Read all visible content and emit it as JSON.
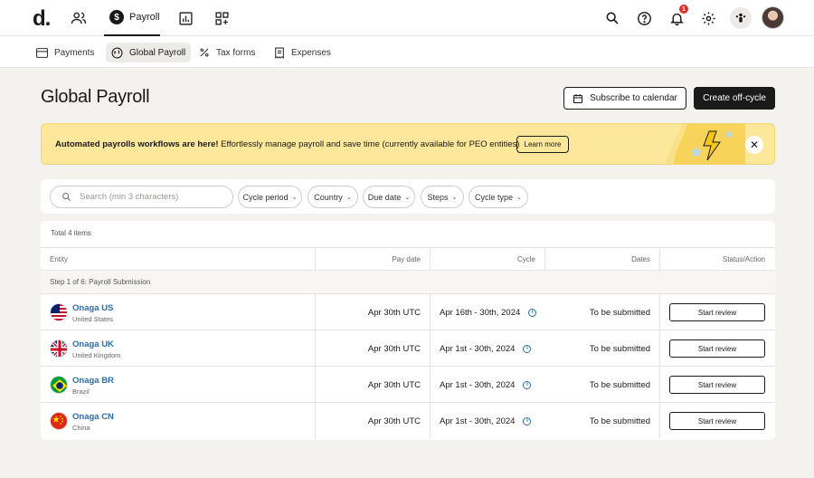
{
  "topbar": {
    "logo": "d.",
    "payroll_label": "Payroll",
    "notification_count": "1",
    "icons": [
      "people-icon",
      "dollar-icon",
      "chart-icon",
      "apps-add-icon",
      "search-icon",
      "help-icon",
      "bell-icon",
      "gear-icon",
      "org-icon",
      "avatar"
    ]
  },
  "subnav": {
    "items": [
      {
        "label": "Payments",
        "icon": "card-icon"
      },
      {
        "label": "Global Payroll",
        "icon": "globe-icon",
        "active": true
      },
      {
        "label": "Tax forms",
        "icon": "percent-icon"
      },
      {
        "label": "Expenses",
        "icon": "receipt-icon"
      }
    ]
  },
  "header": {
    "title": "Global Payroll",
    "subscribe_label": "Subscribe to calendar",
    "create_label": "Create off-cycle"
  },
  "banner": {
    "bold": "Automated payrolls workflows are here!",
    "text": " Effortlessly manage payroll and save time (currently available for PEO entities)",
    "learn_more": "Learn more"
  },
  "filters": {
    "search_placeholder": "Search (min 3 characters)",
    "chips": [
      "Cycle period",
      "Country",
      "Due date",
      "Steps",
      "Cycle type"
    ]
  },
  "table": {
    "total": "Total 4 items",
    "columns": [
      "Entity",
      "Pay date",
      "Cycle",
      "Dates",
      "Status/Action"
    ],
    "step_label": "Step 1 of 6: Payroll Submission",
    "rows": [
      {
        "name": "Onaga US",
        "country": "United States",
        "pay_date": "Apr 30th UTC",
        "cycle": "Apr 16th - 30th, 2024",
        "dates": "To be submitted",
        "action": "Start review"
      },
      {
        "name": "Onaga UK",
        "country": "United Kingdom",
        "pay_date": "Apr 30th UTC",
        "cycle": "Apr 1st - 30th, 2024",
        "dates": "To be submitted",
        "action": "Start review"
      },
      {
        "name": "Onaga BR",
        "country": "Brazil",
        "pay_date": "Apr 30th UTC",
        "cycle": "Apr 1st - 30th, 2024",
        "dates": "To be submitted",
        "action": "Start review"
      },
      {
        "name": "Onaga CN",
        "country": "China",
        "pay_date": "Apr 30th UTC",
        "cycle": "Apr 1st - 30th, 2024",
        "dates": "To be submitted",
        "action": "Start review"
      }
    ]
  },
  "colors": {
    "accent_link": "#2b6cb0",
    "banner_bg": "#fde79a",
    "primary_dark": "#1a1a1a",
    "badge_red": "#e0302b"
  }
}
